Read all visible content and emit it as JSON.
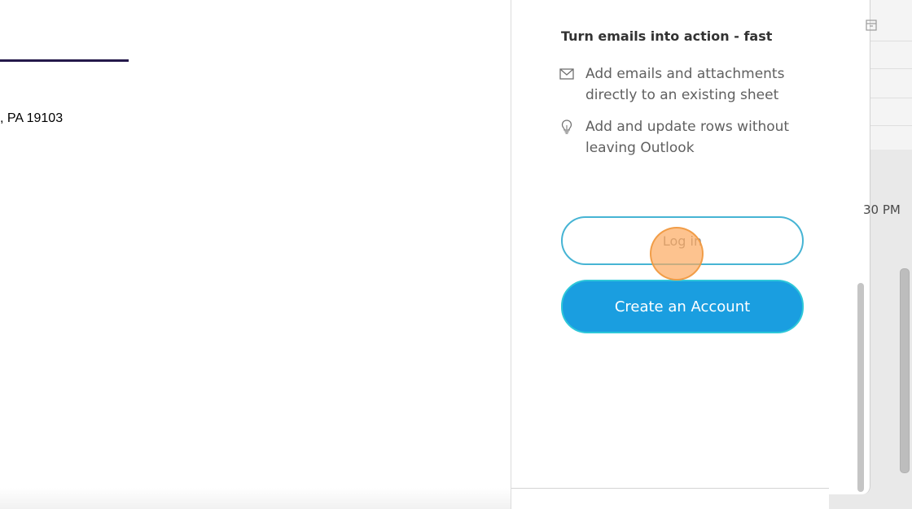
{
  "email": {
    "address_fragment": ", PA 19103"
  },
  "addin": {
    "heading": "Turn emails into action - fast",
    "features": [
      {
        "icon": "envelope-icon",
        "text": "Add emails and attachments directly to an existing sheet"
      },
      {
        "icon": "lightbulb-icon",
        "text": "Add and update rows without leaving Outlook"
      }
    ],
    "login_label": "Log in",
    "create_account_label": "Create an Account"
  },
  "outlook": {
    "time_fragment": "30 PM"
  },
  "colors": {
    "divider": "#24184a",
    "login_border": "#46b4d4",
    "create_bg": "#1a9ee0",
    "click_indicator": "#fcaa5f"
  }
}
